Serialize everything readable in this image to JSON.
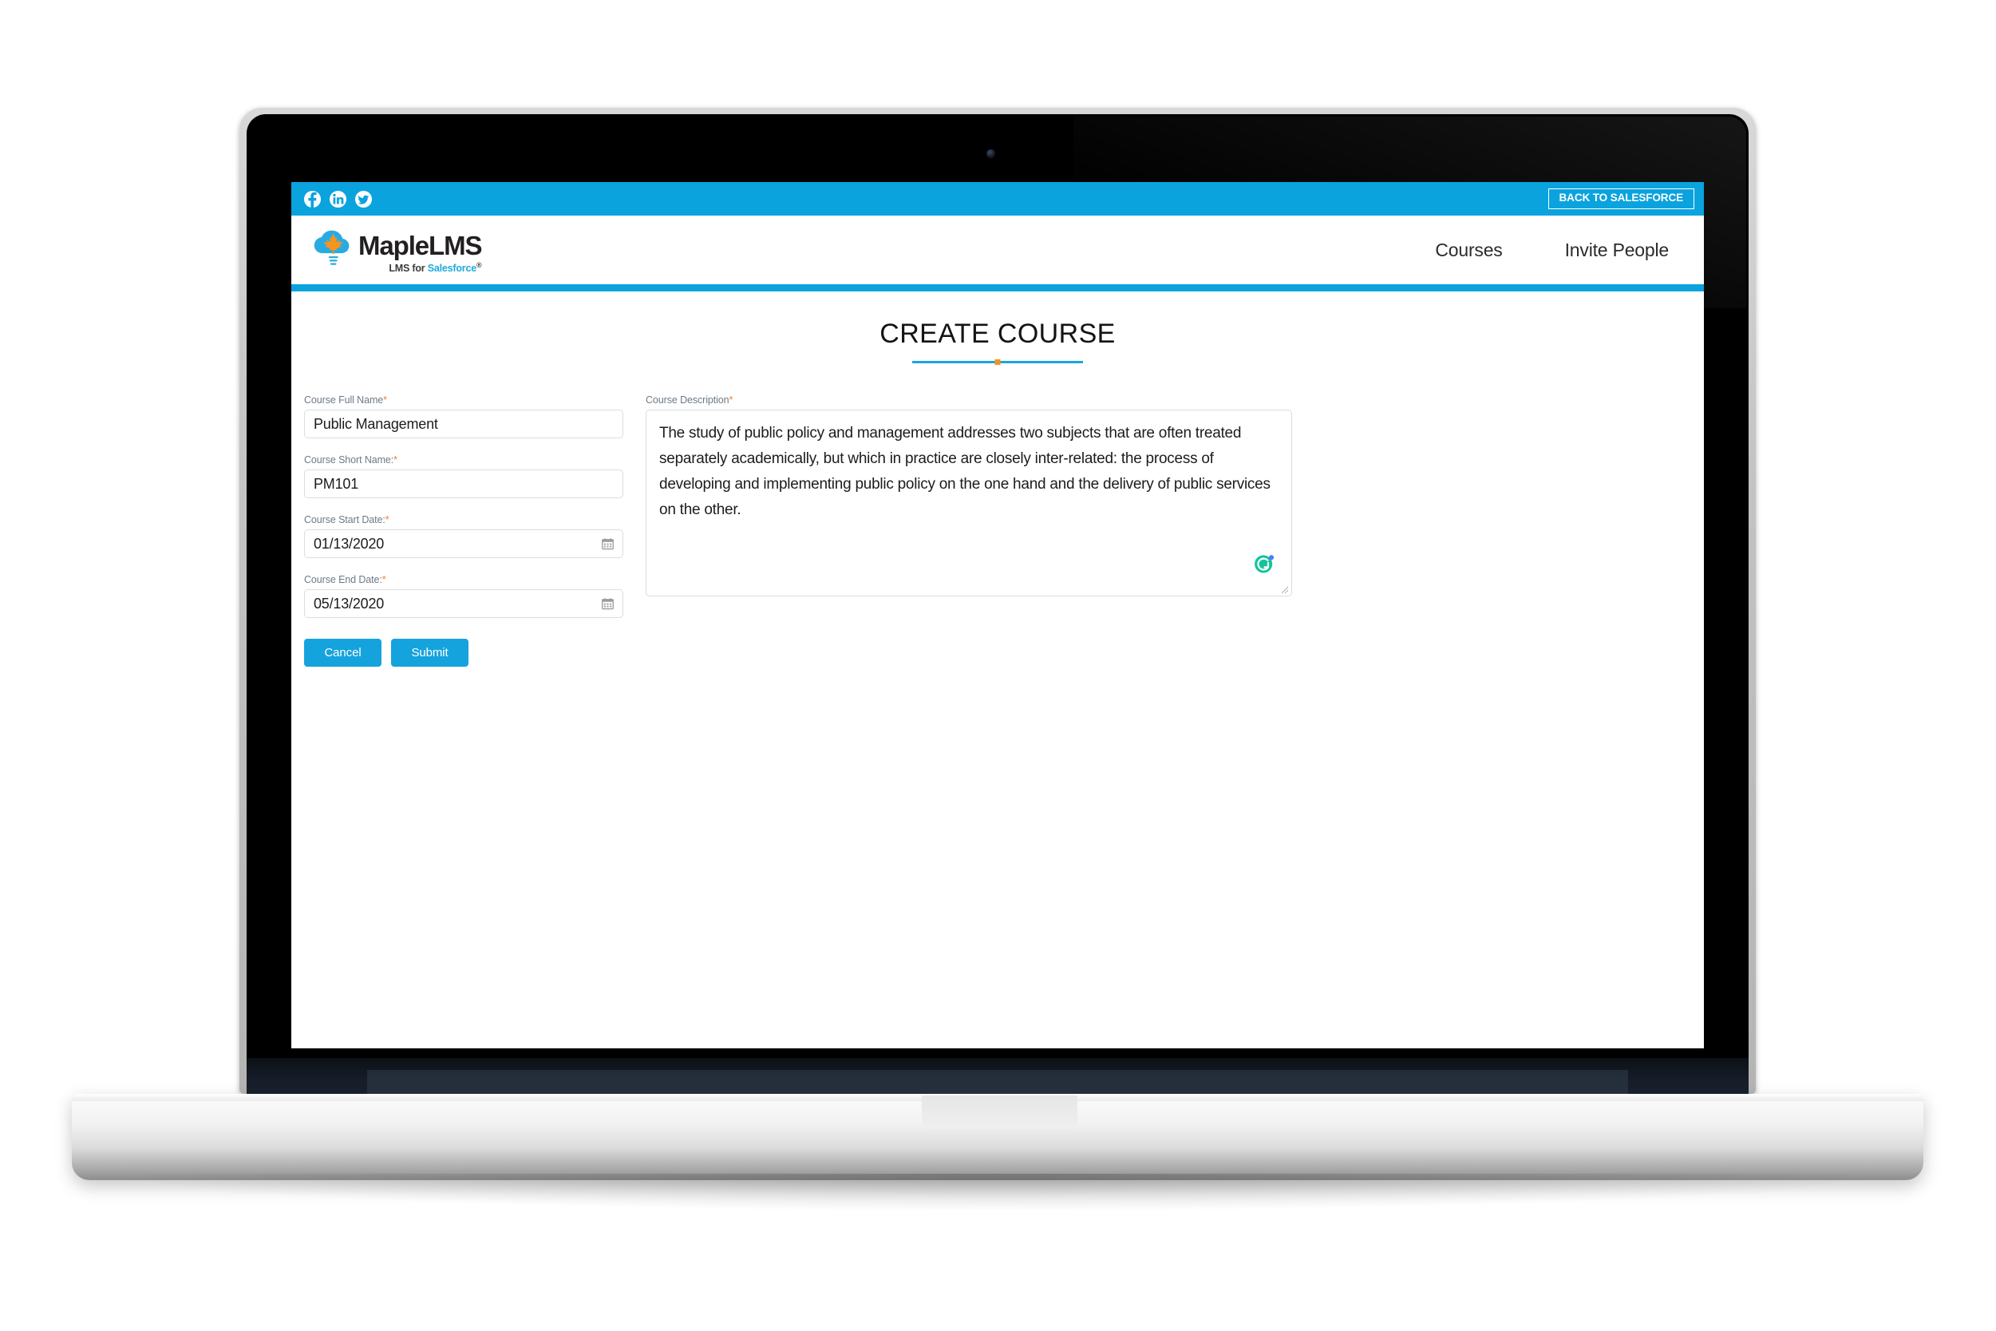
{
  "topbar": {
    "social": [
      {
        "name": "facebook-icon",
        "label": "Facebook"
      },
      {
        "name": "linkedin-icon",
        "label": "LinkedIn"
      },
      {
        "name": "twitter-icon",
        "label": "Twitter"
      }
    ],
    "back_button_label": "BACK TO SALESFORCE",
    "background_color": "#0aa3de"
  },
  "navbar": {
    "logo": {
      "word": "MapleLMS",
      "tagline_prefix": "LMS for ",
      "tagline_brand": "Salesforce",
      "tagline_mark": "®",
      "cloud_color": "#29abe2",
      "leaf_color": "#f7941e"
    },
    "links": [
      {
        "label": "Courses"
      },
      {
        "label": "Invite People"
      }
    ]
  },
  "page": {
    "title": "CREATE COURSE",
    "accent_color": "#1ba4dd",
    "dot_color": "#f6921e"
  },
  "form": {
    "fields": {
      "full_name": {
        "label": "Course Full Name",
        "required_mark": "*",
        "value": "Public Management",
        "placeholder": ""
      },
      "short_name": {
        "label": "Course Short Name:",
        "required_mark": "*",
        "value": "PM101",
        "placeholder": ""
      },
      "start_date": {
        "label": "Course Start Date:",
        "required_mark": "*",
        "value": "01/13/2020",
        "placeholder": "",
        "icon": "calendar-icon"
      },
      "end_date": {
        "label": "Course End Date:",
        "required_mark": "*",
        "value": "05/13/2020",
        "placeholder": "",
        "icon": "calendar-icon"
      },
      "description": {
        "label": "Course Description",
        "required_mark": "*",
        "value": "The study of public policy and management addresses two subjects that are often treated separately academically, but which in practice are closely inter-related: the process of developing and implementing public policy on the one hand and the delivery of public services on the other.",
        "placeholder": "",
        "assistant_icon": "grammarly-icon"
      }
    },
    "buttons": {
      "cancel_label": "Cancel",
      "submit_label": "Submit",
      "color": "#15a3dd"
    }
  }
}
